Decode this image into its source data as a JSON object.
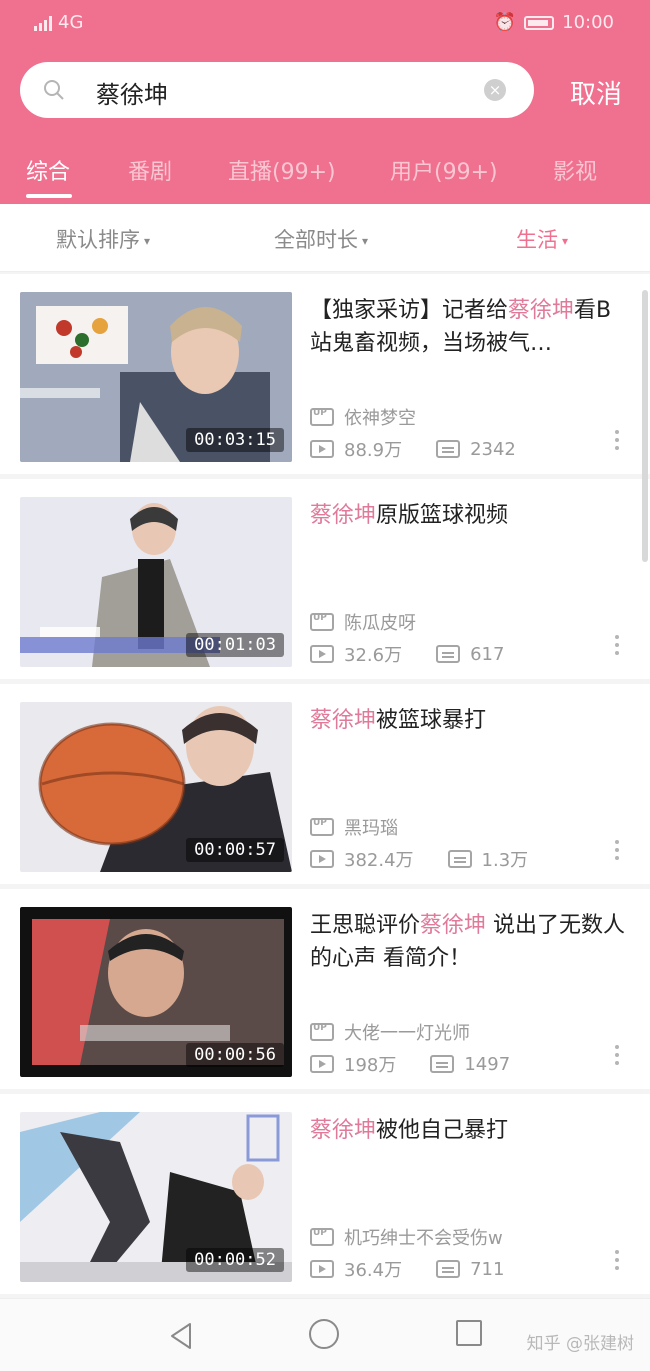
{
  "status_bar": {
    "signal_text": "4G",
    "time": "10:00"
  },
  "search": {
    "query": "蔡徐坤",
    "cancel_label": "取消"
  },
  "tabs": [
    {
      "label": "综合",
      "active": true
    },
    {
      "label": "番剧",
      "active": false
    },
    {
      "label": "直播(99+)",
      "active": false
    },
    {
      "label": "用户(99+)",
      "active": false
    },
    {
      "label": "影视",
      "active": false
    }
  ],
  "filters": [
    {
      "label": "默认排序",
      "active": false
    },
    {
      "label": "全部时长",
      "active": false
    },
    {
      "label": "生活",
      "active": true
    }
  ],
  "videos": [
    {
      "title_pre": "【独家采访】记者给",
      "title_hl": "蔡徐坤",
      "title_post": "看B站鬼畜视频，当场被气…",
      "duration": "00:03:15",
      "uploader": "依神梦空",
      "views": "88.9万",
      "danmaku": "2342"
    },
    {
      "title_pre": "",
      "title_hl": "蔡徐坤",
      "title_post": "原版篮球视频",
      "duration": "00:01:03",
      "uploader": "陈瓜皮呀",
      "views": "32.6万",
      "danmaku": "617"
    },
    {
      "title_pre": "",
      "title_hl": "蔡徐坤",
      "title_post": "被篮球暴打",
      "duration": "00:00:57",
      "uploader": "黑玛瑙",
      "views": "382.4万",
      "danmaku": "1.3万"
    },
    {
      "title_pre": "王思聪评价",
      "title_hl": "蔡徐坤",
      "title_post": " 说出了无数人的心声 看简介！",
      "duration": "00:00:56",
      "uploader": "大佬一一灯光师",
      "views": "198万",
      "danmaku": "1497"
    },
    {
      "title_pre": "",
      "title_hl": "蔡徐坤",
      "title_post": "被他自己暴打",
      "duration": "00:00:52",
      "uploader": "机巧绅士不会受伤w",
      "views": "36.4万",
      "danmaku": "711"
    }
  ],
  "watermark": "知乎 @张建树",
  "colors": {
    "header": "#f0708f",
    "highlight": "#e07a9a"
  }
}
